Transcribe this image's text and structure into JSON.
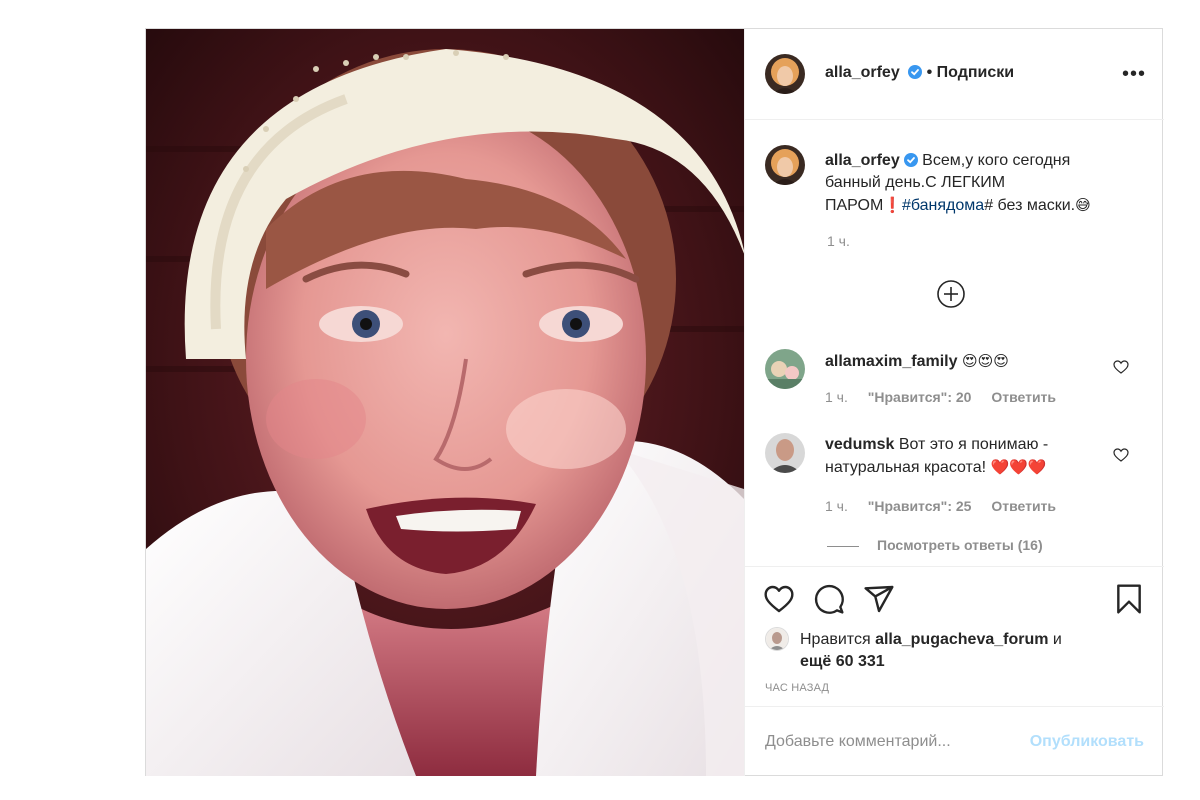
{
  "post": {
    "author": "alla_orfey",
    "follow_label": "• Подписки",
    "more_label": "•••",
    "caption": {
      "username": "alla_orfey",
      "text_part1": "Всем,у кого сегодня банный день.С ЛЕГКИМ ПАРОМ",
      "exclamation": "❗",
      "hashtag": "#банядома",
      "text_part2": "# без маски.",
      "emoji": "😅",
      "time": "1 ч."
    }
  },
  "comments": [
    {
      "username": "allamaxim_family",
      "text": "",
      "emoji": "😍😍😍",
      "time": "1 ч.",
      "likes": "\"Нравится\": 20",
      "reply_label": "Ответить"
    },
    {
      "username": "vedumsk",
      "text": "Вот это я понимаю - натуральная красота!",
      "emoji": "❤️❤️❤️",
      "time": "1 ч.",
      "likes": "\"Нравится\": 25",
      "reply_label": "Ответить",
      "view_replies": "Посмотреть ответы (16)"
    }
  ],
  "likes": {
    "prefix": "Нравится",
    "user": "alla_pugacheva_forum",
    "connector": "и",
    "others": "ещё 60 331"
  },
  "posted_ago": "ЧАС НАЗАД",
  "comment_input": {
    "placeholder": "Добавьте комментарий..."
  },
  "publish_label": "Опубликовать",
  "colors": {
    "verified": "#3897f0",
    "hashtag": "#00376b",
    "publish_disabled": "#b2dffc",
    "border": "#dbdbdb",
    "muted": "#8e8e8e"
  }
}
